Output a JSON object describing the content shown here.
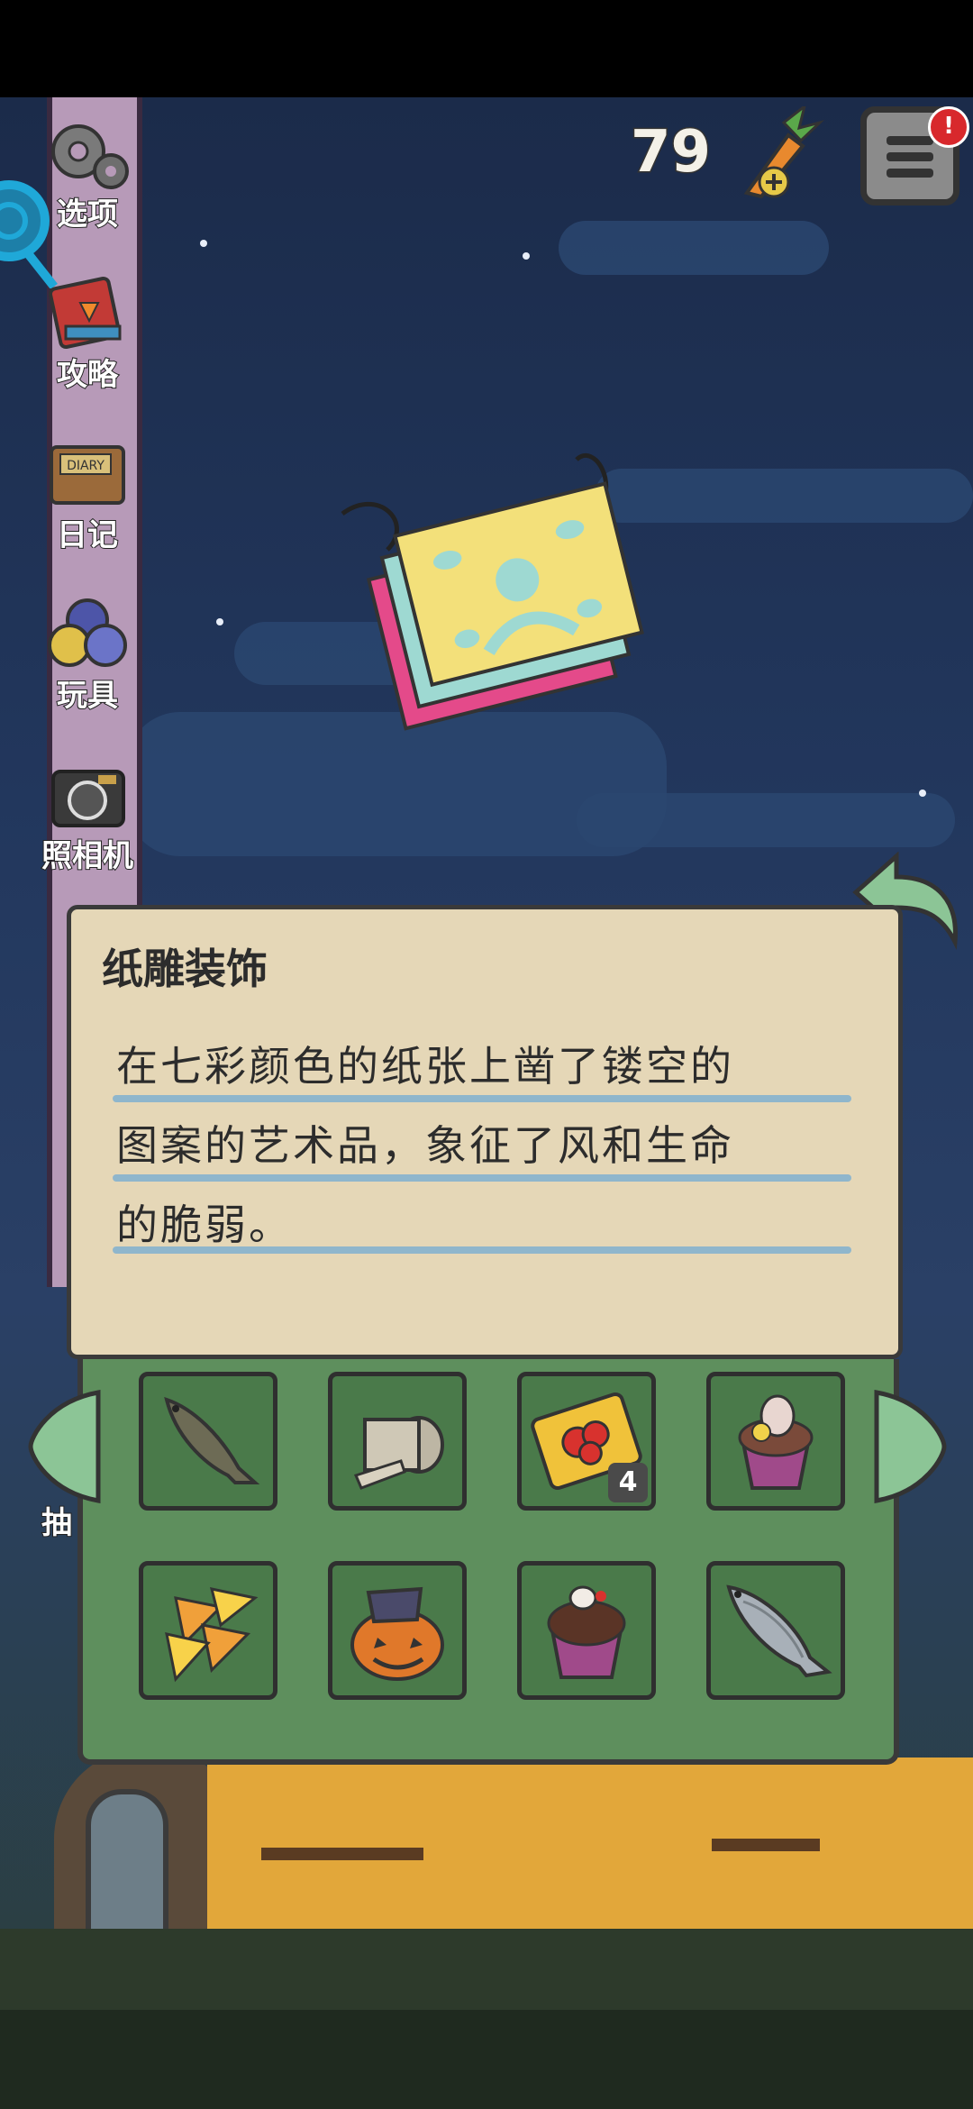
{
  "currency": {
    "carrot_count": "79",
    "icon": "carrot-plus-icon"
  },
  "notification": {
    "badge": "!"
  },
  "sidebar": {
    "items": [
      {
        "label": "选项",
        "icon": "gear-icon"
      },
      {
        "label": "攻略",
        "icon": "guide-book-icon"
      },
      {
        "label": "日记",
        "icon": "diary-icon"
      },
      {
        "label": "玩具",
        "icon": "toy-balls-icon"
      },
      {
        "label": "照相机",
        "icon": "camera-icon"
      }
    ],
    "partial_label": "抽"
  },
  "item_detail": {
    "name": "纸雕装饰",
    "description_lines": [
      "在七彩颜色的纸张上凿了镂空的",
      "图案的艺术品，象征了风和生命",
      "的脆弱。"
    ]
  },
  "inventory": {
    "slots": [
      {
        "icon": "fish-icon",
        "count": ""
      },
      {
        "icon": "bandage-roll-icon",
        "count": ""
      },
      {
        "icon": "ticket-icon",
        "count": "4"
      },
      {
        "icon": "cupcake-icon",
        "count": ""
      },
      {
        "icon": "candy-corn-icon",
        "count": ""
      },
      {
        "icon": "pumpkin-hat-icon",
        "count": ""
      },
      {
        "icon": "chocolate-cupcake-icon",
        "count": ""
      },
      {
        "icon": "silver-fish-icon",
        "count": ""
      }
    ]
  },
  "colors": {
    "card_bg": "#e5d7b7",
    "inventory_bg": "#5e8f5d",
    "underline": "#8fb6cc",
    "sky": "#22375d"
  }
}
